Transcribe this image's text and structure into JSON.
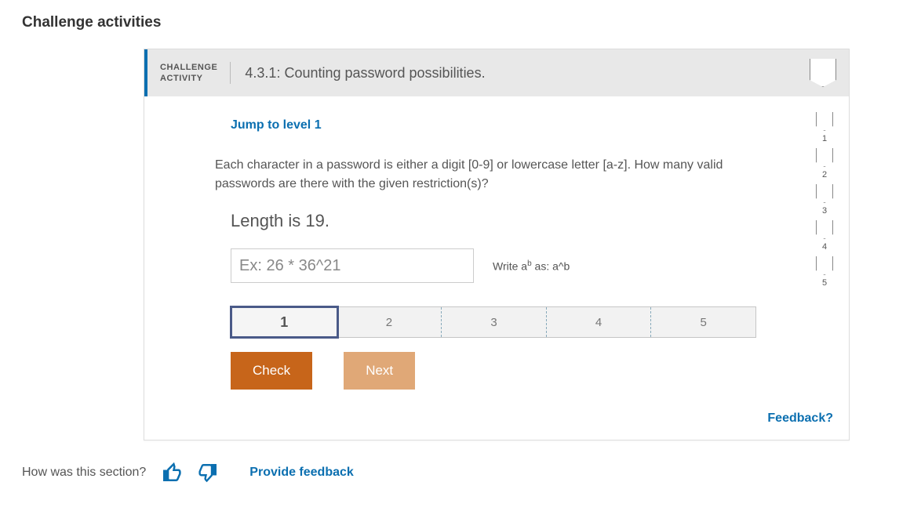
{
  "page": {
    "title": "Challenge activities"
  },
  "header": {
    "label_line1": "CHALLENGE",
    "label_line2": "ACTIVITY",
    "title": "4.3.1: Counting password possibilities."
  },
  "body": {
    "jump_link": "Jump to level 1",
    "prompt": "Each character in a password is either a digit [0-9] or lowercase letter [a-z]. How many valid passwords are there with the given restriction(s)?",
    "length_text": "Length is 19.",
    "input_placeholder": "Ex: 26 * 36^21",
    "hint_prefix": "Write a",
    "hint_sup": "b",
    "hint_suffix": " as: a^b"
  },
  "steps": [
    "1",
    "2",
    "3",
    "4",
    "5"
  ],
  "active_step_index": 0,
  "buttons": {
    "check": "Check",
    "next": "Next"
  },
  "side_levels": [
    "1",
    "2",
    "3",
    "4",
    "5"
  ],
  "feedback_link": "Feedback?",
  "footer": {
    "question": "How was this section?",
    "provide": "Provide feedback"
  }
}
